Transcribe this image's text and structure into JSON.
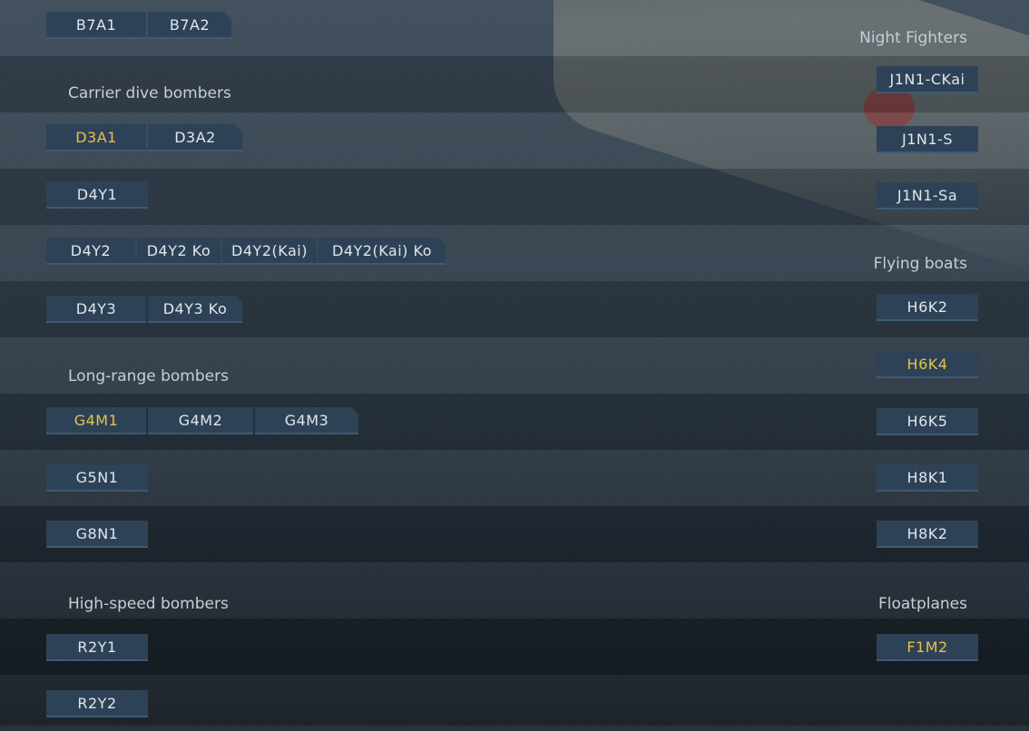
{
  "colors": {
    "accent_gold": "#e6c24a",
    "button_bg": "#2e4257",
    "text": "#dfe6ec"
  },
  "left": {
    "b7a": {
      "items": [
        {
          "label": "B7A1"
        },
        {
          "label": "B7A2"
        }
      ]
    },
    "carrier_dive_bombers": {
      "heading": "Carrier dive bombers"
    },
    "d3a": {
      "items": [
        {
          "label": "D3A1",
          "highlight": true
        },
        {
          "label": "D3A2"
        }
      ]
    },
    "d4y1": {
      "label": "D4Y1"
    },
    "d4y2": {
      "items": [
        {
          "label": "D4Y2"
        },
        {
          "label": "D4Y2 Ko"
        },
        {
          "label": "D4Y2(Kai)"
        },
        {
          "label": "D4Y2(Kai) Ko"
        }
      ]
    },
    "d4y3": {
      "items": [
        {
          "label": "D4Y3"
        },
        {
          "label": "D4Y3 Ko"
        }
      ]
    },
    "long_range_bombers": {
      "heading": "Long-range bombers"
    },
    "g4m": {
      "items": [
        {
          "label": "G4M1",
          "highlight": true
        },
        {
          "label": "G4M2"
        },
        {
          "label": "G4M3"
        }
      ]
    },
    "g5n1": {
      "label": "G5N1"
    },
    "g8n1": {
      "label": "G8N1"
    },
    "high_speed_bombers": {
      "heading": "High-speed bombers"
    },
    "r2y1": {
      "label": "R2Y1"
    },
    "r2y2": {
      "label": "R2Y2"
    }
  },
  "right": {
    "night_fighters": {
      "heading": "Night Fighters"
    },
    "j1n1_ckai": {
      "label": "J1N1-CKai"
    },
    "j1n1_s": {
      "label": "J1N1-S"
    },
    "j1n1_sa": {
      "label": "J1N1-Sa"
    },
    "flying_boats": {
      "heading": "Flying boats"
    },
    "h6k2": {
      "label": "H6K2"
    },
    "h6k4": {
      "label": "H6K4",
      "highlight": true
    },
    "h6k5": {
      "label": "H6K5"
    },
    "h8k1": {
      "label": "H8K1"
    },
    "h8k2": {
      "label": "H8K2"
    },
    "floatplanes": {
      "heading": "Floatplanes"
    },
    "f1m2": {
      "label": "F1M2",
      "highlight": true
    }
  }
}
